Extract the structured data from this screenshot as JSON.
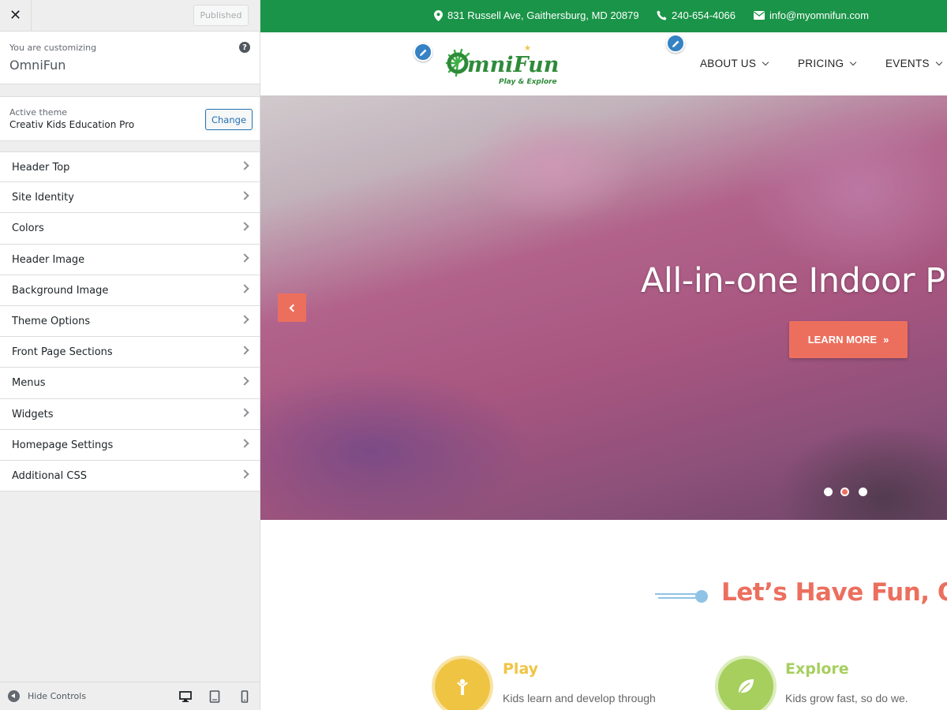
{
  "customizer": {
    "published_label": "Published",
    "info_pre": "You are customizing",
    "site_name": "OmniFun",
    "help_icon": "?",
    "theme_pre": "Active theme",
    "theme_name": "Creativ Kids Education Pro",
    "change_label": "Change",
    "sections": [
      "Header Top",
      "Site Identity",
      "Colors",
      "Header Image",
      "Background Image",
      "Theme Options",
      "Front Page Sections",
      "Menus",
      "Widgets",
      "Homepage Settings",
      "Additional CSS"
    ],
    "hide_controls": "Hide Controls",
    "icons": {
      "close": "close-icon",
      "help": "help-icon",
      "chevron": "chevron-right-icon",
      "hide": "collapse-icon",
      "desktop": "desktop-icon",
      "tablet": "tablet-icon",
      "mobile": "mobile-icon"
    }
  },
  "site": {
    "colors": {
      "topbar": "#1a9448",
      "accent": "#ec6f5e",
      "play": "#f0c443",
      "explore": "#a6cf5e",
      "edit_pin": "#3582c4"
    },
    "topbar": {
      "address": "831 Russell Ave, Gaithersburg, MD 20879",
      "phone": "240-654-4066",
      "email": "info@myomnifun.com"
    },
    "logo": {
      "name": "OmniFun",
      "tagline": "Play & Explore"
    },
    "nav": [
      "ABOUT US",
      "PRICING",
      "EVENTS"
    ],
    "hero": {
      "title": "All-in-one Indoor Play",
      "button": "LEARN MORE",
      "slides": 3,
      "active_slide": 2
    },
    "welcome_title": "Let’s Have Fun, OmniFun",
    "features": [
      {
        "title": "Play",
        "text": "Kids learn and develop through",
        "icon": "child-icon"
      },
      {
        "title": "Explore",
        "text": "Kids grow fast, so do we.",
        "icon": "leaf-icon"
      }
    ]
  }
}
